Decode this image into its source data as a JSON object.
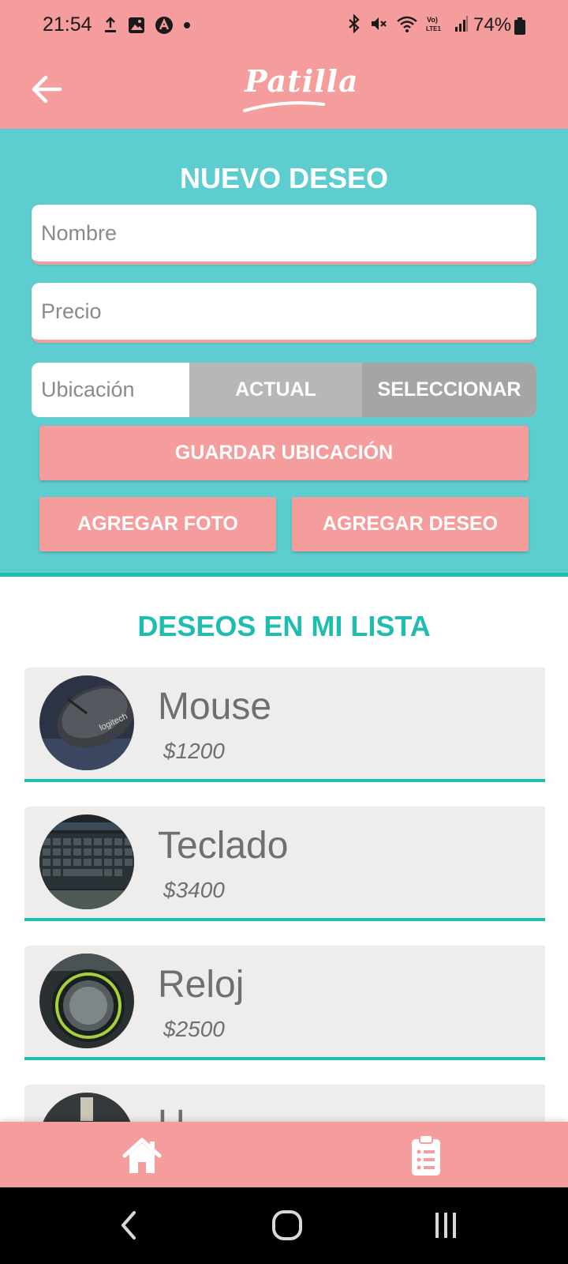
{
  "status_bar": {
    "time": "21:54",
    "battery": "74%"
  },
  "app_bar": {
    "logo": "Patilla"
  },
  "form": {
    "title": "NUEVO DESEO",
    "name_placeholder": "Nombre",
    "price_placeholder": "Precio",
    "location_label": "Ubicación",
    "actual_button": "ACTUAL",
    "select_button": "SELECCIONAR",
    "save_location_button": "GUARDAR UBICACIÓN",
    "add_photo_button": "AGREGAR FOTO",
    "add_wish_button": "AGREGAR DESEO"
  },
  "list": {
    "title": "DESEOS EN MI LISTA",
    "items": [
      {
        "name": "Mouse",
        "price": "$1200"
      },
      {
        "name": "Teclado",
        "price": "$3400"
      },
      {
        "name": "Reloj",
        "price": "$2500"
      },
      {
        "name": "U",
        "price": ""
      }
    ]
  },
  "colors": {
    "pink": "#f59c9c",
    "teal": "#5ecdcf",
    "accent_teal": "#1fbdb0",
    "item_bg": "#efedeb"
  }
}
